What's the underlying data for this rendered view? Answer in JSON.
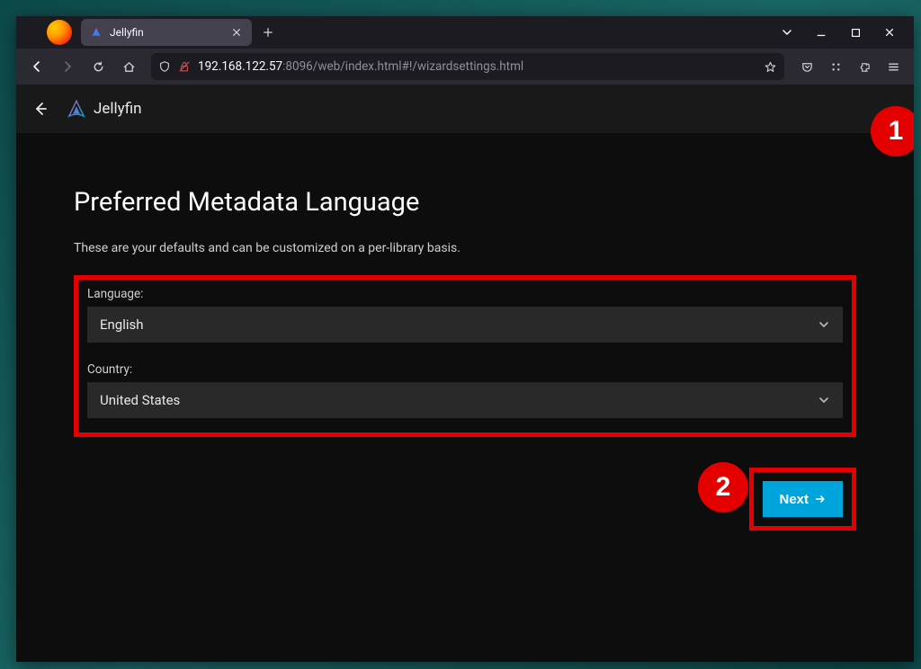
{
  "browser": {
    "tab_title": "Jellyfin",
    "url_host": "192.168.122.57",
    "url_rest": ":8096/web/index.html#!/wizardsettings.html"
  },
  "app_header": {
    "brand": "Jellyfin"
  },
  "page": {
    "heading": "Preferred Metadata Language",
    "subtitle": "These are your defaults and can be customized on a per-library basis.",
    "language_label": "Language:",
    "language_value": "English",
    "country_label": "Country:",
    "country_value": "United States",
    "prev_fragment": ";",
    "next_label": "Next"
  },
  "annotations": {
    "badge1": "1",
    "badge2": "2"
  }
}
